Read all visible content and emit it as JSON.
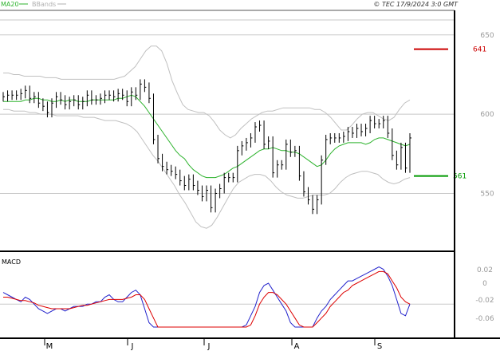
{
  "header": {
    "legend": [
      {
        "label": "MA20",
        "color": "#2db32d"
      },
      {
        "label": "BBands",
        "color": "#b0b0b0"
      }
    ],
    "timestamp": "© TEC 17/9/2024 3:0 GMT"
  },
  "colors": {
    "price": "#000000",
    "ma20": "#2db32d",
    "bbands": "#c0c0c0",
    "resistance": "#cc0000",
    "support": "#009900",
    "macd": "#2222cc",
    "signal": "#dd0000",
    "grid": "#c8c8c8",
    "axis_text": "#999999"
  },
  "chart_data": [
    {
      "type": "ohlc",
      "title": "",
      "ylim": [
        515,
        665
      ],
      "y_ticks": [
        "550",
        "600",
        "650"
      ],
      "grid": true,
      "x_ticks": [
        "M",
        "J",
        "J",
        "A",
        "S"
      ],
      "levels": [
        {
          "label": "641",
          "value": 641,
          "role": "resistance"
        },
        {
          "label": "561",
          "value": 561,
          "role": "support"
        }
      ],
      "close": [
        611,
        612,
        612,
        612,
        613,
        615,
        610,
        611,
        607,
        605,
        601,
        607,
        611,
        609,
        606,
        608,
        609,
        606,
        608,
        612,
        609,
        609,
        610,
        612,
        612,
        611,
        613,
        612,
        608,
        614,
        612,
        619,
        617,
        610,
        584,
        572,
        567,
        565,
        564,
        562,
        558,
        555,
        559,
        555,
        552,
        548,
        552,
        541,
        550,
        553,
        560,
        560,
        560,
        577,
        580,
        582,
        585,
        592,
        593,
        581,
        583,
        563,
        568,
        568,
        581,
        576,
        577,
        561,
        551,
        546,
        540,
        546,
        571,
        584,
        585,
        585,
        585,
        586,
        589,
        588,
        591,
        589,
        591,
        596,
        594,
        594,
        596,
        588,
        574,
        568,
        579,
        566,
        585
      ],
      "ma20": [
        608,
        608,
        608,
        608,
        608,
        609,
        609,
        610,
        610,
        609,
        609,
        608,
        608,
        609,
        608,
        609,
        609,
        608,
        608,
        608,
        609,
        609,
        609,
        609,
        609,
        609,
        610,
        610,
        611,
        612,
        611,
        608,
        605,
        601,
        597,
        593,
        589,
        585,
        581,
        577,
        574,
        572,
        568,
        565,
        563,
        561,
        560,
        560,
        560,
        561,
        562,
        564,
        566,
        567,
        569,
        571,
        573,
        575,
        577,
        578,
        578,
        579,
        578,
        577,
        577,
        576,
        576,
        575,
        573,
        571,
        569,
        567,
        568,
        571,
        575,
        578,
        580,
        581,
        582,
        582,
        582,
        582,
        581,
        582,
        584,
        585,
        585,
        584,
        583,
        582,
        581,
        580,
        581
      ],
      "bb_upper": [
        626,
        626,
        625,
        625,
        624,
        624,
        624,
        624,
        623,
        623,
        623,
        622,
        622,
        622,
        622,
        622,
        622,
        622,
        622,
        622,
        622,
        622,
        623,
        624,
        627,
        630,
        635,
        640,
        643,
        643,
        640,
        632,
        621,
        613,
        606,
        603,
        602,
        601,
        601,
        599,
        595,
        590,
        587,
        585,
        587,
        591,
        594,
        597,
        599,
        601,
        602,
        602,
        603,
        604,
        604,
        604,
        604,
        604,
        604,
        603,
        603,
        601,
        598,
        594,
        590,
        590,
        593,
        597,
        600,
        601,
        601,
        599,
        597,
        596,
        598,
        603,
        607,
        609
      ],
      "bb_lower": [
        603,
        603,
        602,
        602,
        602,
        601,
        601,
        600,
        600,
        600,
        599,
        599,
        599,
        599,
        599,
        598,
        598,
        598,
        597,
        596,
        596,
        596,
        595,
        594,
        592,
        589,
        584,
        579,
        574,
        570,
        565,
        560,
        555,
        549,
        544,
        538,
        532,
        529,
        528,
        530,
        535,
        541,
        547,
        553,
        557,
        559,
        561,
        562,
        562,
        561,
        558,
        554,
        551,
        549,
        548,
        547,
        547,
        548,
        549,
        549,
        549,
        550,
        553,
        557,
        560,
        562,
        563,
        564,
        564,
        563,
        562,
        559,
        557,
        556,
        557,
        559,
        560
      ]
    },
    {
      "type": "line",
      "title": "MACD",
      "ylim": [
        -0.014,
        0.021
      ],
      "y_ticks": [
        "0.02",
        "0",
        "-0.02",
        "-0.06"
      ],
      "x_ticks": [
        "M",
        "J",
        "J",
        "A",
        "S"
      ],
      "series": [
        {
          "values": [
            0.005,
            0.004,
            0.003,
            0.002,
            0.001,
            0.003,
            0.002,
            0.0,
            -0.002,
            -0.003,
            -0.004,
            -0.003,
            -0.002,
            -0.002,
            -0.003,
            -0.002,
            -0.001,
            -0.001,
            -0.001,
            0.0,
            0.0,
            0.001,
            0.001,
            0.003,
            0.004,
            0.002,
            0.001,
            0.001,
            0.003,
            0.005,
            0.006,
            0.004,
            -0.002,
            -0.008,
            -0.013,
            -0.018,
            -0.022,
            -0.025,
            -0.027,
            -0.028,
            -0.03,
            -0.031,
            -0.032,
            -0.034,
            -0.035,
            -0.036,
            -0.037,
            -0.039,
            -0.039,
            -0.037,
            -0.034,
            -0.03,
            -0.025,
            -0.019,
            -0.014,
            -0.009,
            -0.005,
            -0.001,
            0.005,
            0.008,
            0.009,
            0.006,
            0.003,
            0.0,
            -0.003,
            -0.008,
            -0.012,
            -0.016,
            -0.016,
            -0.013,
            -0.01,
            -0.006,
            -0.003,
            -0.001,
            0.002,
            0.004,
            0.006,
            0.008,
            0.01,
            0.01,
            0.011,
            0.012,
            0.013,
            0.014,
            0.015,
            0.016,
            0.015,
            0.012,
            0.008,
            0.002,
            -0.004,
            -0.005,
            0.0
          ]
        },
        {
          "values": [
            0.003,
            0.003,
            0.0025,
            0.002,
            0.0015,
            0.0015,
            0.001,
            0.0005,
            -0.0005,
            -0.001,
            -0.0015,
            -0.002,
            -0.002,
            -0.002,
            -0.002,
            -0.002,
            -0.0015,
            -0.001,
            -0.0005,
            -0.0005,
            0.0,
            0.0005,
            0.001,
            0.0015,
            0.002,
            0.002,
            0.002,
            0.002,
            0.0025,
            0.003,
            0.004,
            0.004,
            0.002,
            -0.002,
            -0.006,
            -0.01,
            -0.014,
            -0.017,
            -0.019,
            -0.021,
            -0.023,
            -0.025,
            -0.027,
            -0.028,
            -0.029,
            -0.03,
            -0.031,
            -0.032,
            -0.033,
            -0.033,
            -0.032,
            -0.03,
            -0.027,
            -0.023,
            -0.018,
            -0.013,
            -0.009,
            -0.005,
            0.0,
            0.003,
            0.005,
            0.005,
            0.004,
            0.002,
            0.0,
            -0.003,
            -0.006,
            -0.009,
            -0.011,
            -0.011,
            -0.01,
            -0.008,
            -0.006,
            -0.004,
            -0.001,
            0.001,
            0.003,
            0.005,
            0.006,
            0.008,
            0.009,
            0.01,
            0.011,
            0.012,
            0.013,
            0.014,
            0.014,
            0.013,
            0.01,
            0.007,
            0.003,
            0.001,
            0.0
          ]
        }
      ]
    }
  ]
}
